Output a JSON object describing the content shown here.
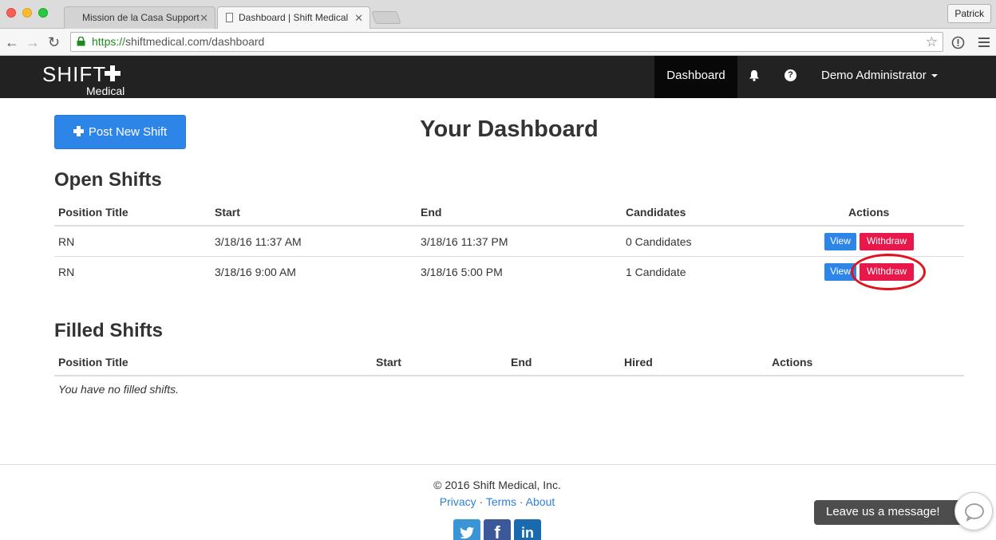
{
  "browser": {
    "tabs": [
      {
        "label": "Mission de la Casa Support",
        "close": "✕"
      },
      {
        "label": "Dashboard | Shift Medical",
        "close": "✕"
      }
    ],
    "profile": "Patrick",
    "url_scheme": "https://",
    "url_rest": "shiftmedical.com/dashboard",
    "icons": [
      "back-arrow-icon",
      "forward-arrow-icon",
      "reload-icon",
      "lock-icon",
      "star-icon",
      "info-icon",
      "menu-icon"
    ]
  },
  "nav": {
    "logo_main": "SHIFT",
    "logo_sub": "Medical",
    "dashboard": "Dashboard",
    "user": "Demo Administrator",
    "help_glyph": "?"
  },
  "main": {
    "post_button": "Post New Shift",
    "title": "Your Dashboard",
    "open": {
      "title": "Open Shifts",
      "headers": [
        "Position Title",
        "Start",
        "End",
        "Candidates",
        "Actions"
      ],
      "rows": [
        {
          "position": "RN",
          "start": "3/18/16 11:37 AM",
          "end": "3/18/16 11:37 PM",
          "candidates": "0 Candidates",
          "view": "View",
          "withdraw": "Withdraw"
        },
        {
          "position": "RN",
          "start": "3/18/16 9:00 AM",
          "end": "3/18/16 5:00 PM",
          "candidates": "1 Candidate",
          "view": "View",
          "withdraw": "Withdraw"
        }
      ]
    },
    "filled": {
      "title": "Filled Shifts",
      "headers": [
        "Position Title",
        "Start",
        "End",
        "Hired",
        "Actions"
      ],
      "empty": "You have no filled shifts."
    }
  },
  "footer": {
    "copyright": "© 2016 Shift Medical, Inc.",
    "links": [
      "Privacy",
      "Terms",
      "About"
    ],
    "separator": " · ",
    "social": [
      "twitter-icon",
      "facebook-icon",
      "linkedin-icon"
    ],
    "fb_glyph": "f",
    "li_glyph": "in"
  },
  "chat": {
    "label": "Leave us a message!"
  },
  "colors": {
    "primary": "#2e85e8",
    "danger": "#e8184a",
    "navbar": "#222222",
    "annotation": "#e0141a"
  }
}
